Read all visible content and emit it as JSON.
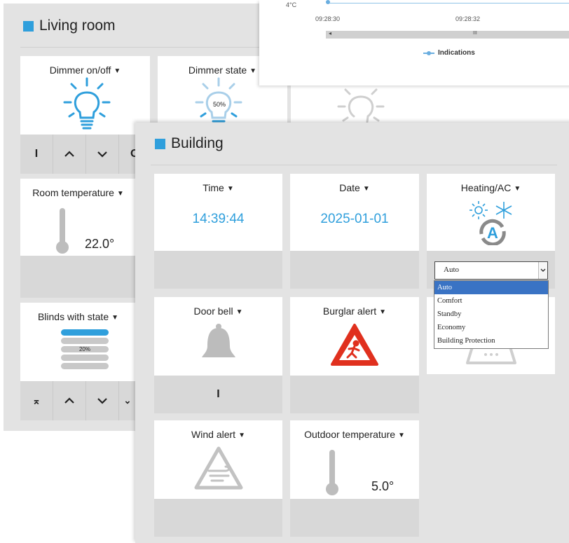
{
  "chart": {
    "y_tick": "4°C",
    "x_ticks": [
      "09:28:30",
      "09:28:32"
    ],
    "legend": "Indications",
    "scrollbar_thumb": "III"
  },
  "living_room": {
    "title": "Living room",
    "tiles": {
      "dimmer_onoff": {
        "title": "Dimmer on/off",
        "buttons": [
          "I",
          "^",
          "v",
          "O"
        ]
      },
      "dimmer_state": {
        "title": "Dimmer state",
        "percent": "50%"
      },
      "room_temperature": {
        "title": "Room temperature",
        "value": "22.0°"
      },
      "blinds": {
        "title": "Blinds with state",
        "percent": "20%",
        "buttons": [
          "⌅",
          "^",
          "v",
          "⌄"
        ]
      }
    }
  },
  "building": {
    "title": "Building",
    "tiles": {
      "time": {
        "title": "Time",
        "value": "14:39:44"
      },
      "date": {
        "title": "Date",
        "value": "2025-01-01"
      },
      "heating": {
        "title": "Heating/AC",
        "selected": "Auto",
        "options": [
          "Auto",
          "Comfort",
          "Standby",
          "Economy",
          "Building Protection"
        ]
      },
      "door_bell": {
        "title": "Door bell",
        "button": "I"
      },
      "burglar": {
        "title": "Burglar alert"
      },
      "wind": {
        "title": "Wind alert"
      },
      "outdoor": {
        "title": "Outdoor temperature",
        "value": "5.0°"
      }
    }
  },
  "colors": {
    "accent": "#2f9fdc",
    "alert_red": "#e0301e",
    "grey_icon": "#bcbcbc",
    "selected_option": "#3a73c4"
  }
}
